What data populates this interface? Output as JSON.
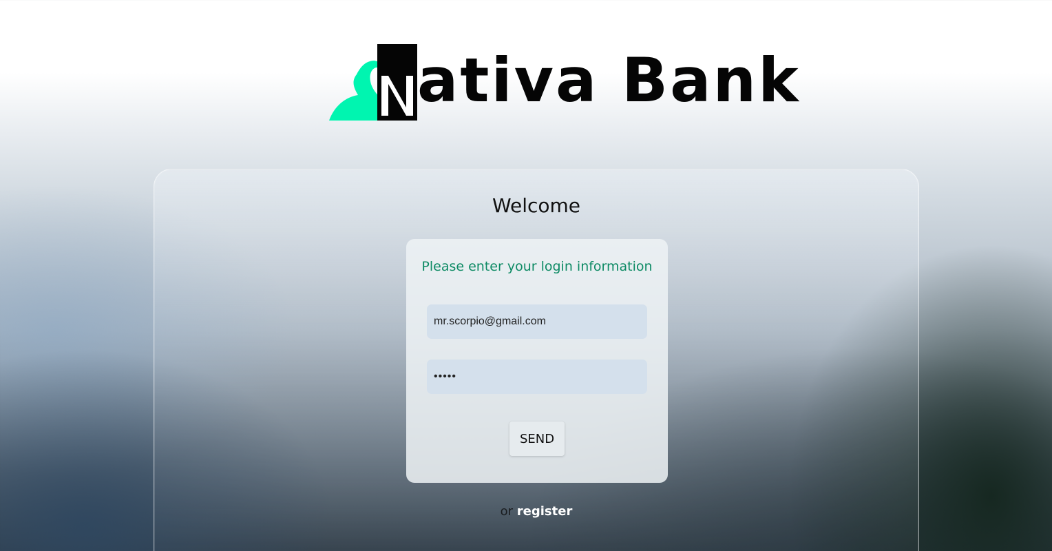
{
  "brand": {
    "name": "Nativa Bank",
    "wordmark_rest": "ativa Bank",
    "logo_icon": "heron-bird-icon",
    "accent_color": "#00f5b0"
  },
  "panel": {
    "heading": "Welcome"
  },
  "login_card": {
    "prompt": "Please enter your login information",
    "email_value": "mr.scorpio@gmail.com",
    "password_value": "*****",
    "send_label": "SEND"
  },
  "footer": {
    "or_text": "or",
    "register_label": "register"
  }
}
